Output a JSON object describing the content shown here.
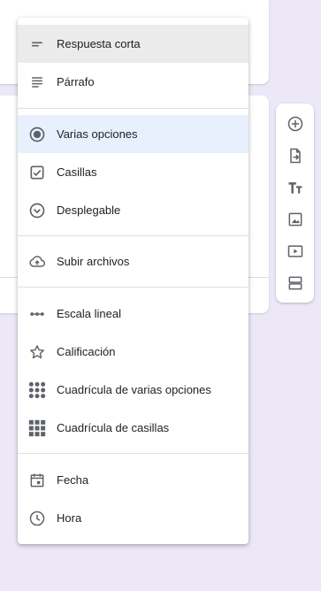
{
  "menu": {
    "items": [
      {
        "label": "Respuesta corta",
        "icon": "short-answer-icon"
      },
      {
        "label": "Párrafo",
        "icon": "paragraph-icon"
      },
      {
        "label": "Varias opciones",
        "icon": "radio-button-icon"
      },
      {
        "label": "Casillas",
        "icon": "checkbox-icon"
      },
      {
        "label": "Desplegable",
        "icon": "dropdown-icon"
      },
      {
        "label": "Subir archivos",
        "icon": "cloud-upload-icon"
      },
      {
        "label": "Escala lineal",
        "icon": "linear-scale-icon"
      },
      {
        "label": "Calificación",
        "icon": "star-icon"
      },
      {
        "label": "Cuadrícula de varias opciones",
        "icon": "grid-dots-icon"
      },
      {
        "label": "Cuadrícula de casillas",
        "icon": "grid-squares-icon"
      },
      {
        "label": "Fecha",
        "icon": "calendar-icon"
      },
      {
        "label": "Hora",
        "icon": "clock-icon"
      }
    ]
  },
  "toolbar": {
    "buttons": [
      "add-question-icon",
      "import-questions-icon",
      "add-title-icon",
      "add-image-icon",
      "add-video-icon",
      "add-section-icon"
    ]
  },
  "colors": {
    "background": "#ece8f8",
    "icon": "#5f6368",
    "selected_highlight": "#ebebeb",
    "active_highlight": "#e8f0fe"
  }
}
